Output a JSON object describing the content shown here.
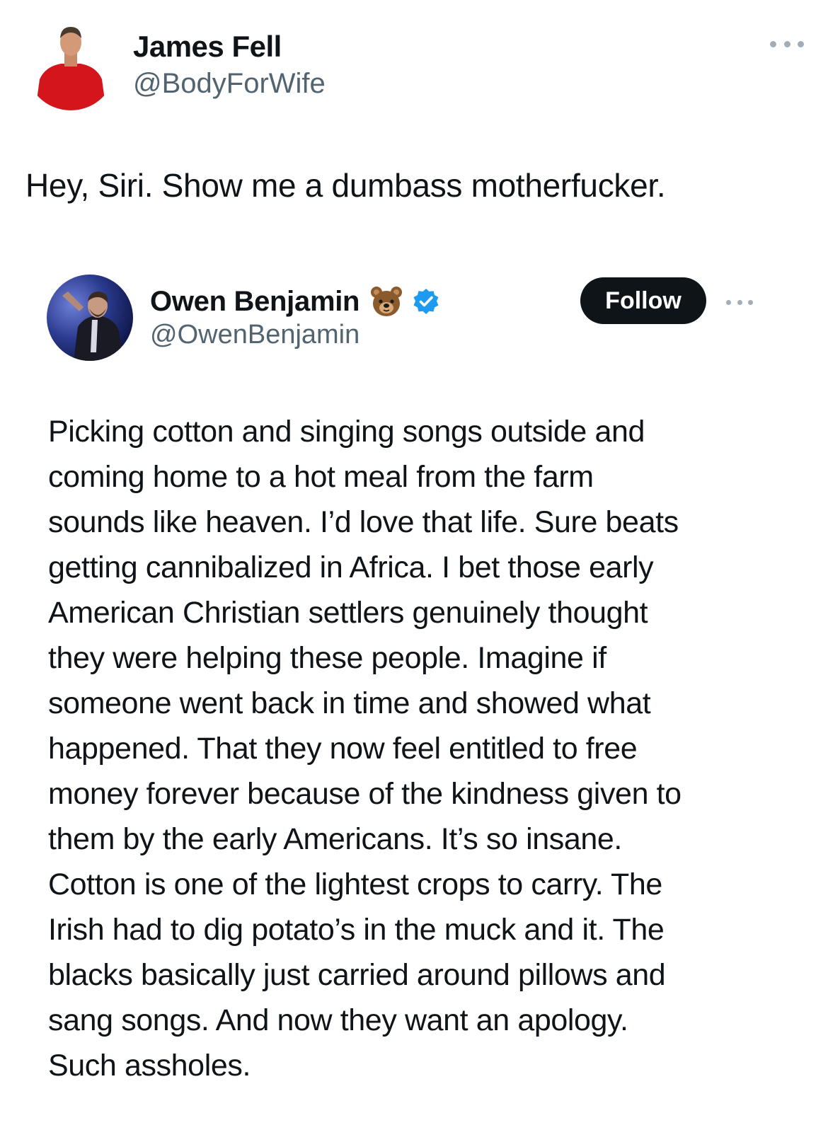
{
  "outer_tweet": {
    "author_name": "James Fell",
    "author_handle": "@BodyForWife",
    "more_icon": "more-dots-icon",
    "text": "Hey, Siri. Show me a dumbass motherfucker."
  },
  "quoted_tweet": {
    "author_name": "Owen Benjamin",
    "author_handle": "@OwenBenjamin",
    "name_emoji_icon": "bear-face-icon",
    "verified_icon": "verified-badge-icon",
    "follow_label": "Follow",
    "more_icon": "more-dots-icon",
    "text_lines": [
      "Picking cotton and singing songs outside and",
      "coming home to a hot meal from the farm",
      "sounds like heaven. I’d love that life. Sure beats",
      "getting cannibalized in Africa. I bet those early",
      "American Christian settlers genuinely thought",
      "they were helping these people. Imagine if",
      "someone went back in time and showed what",
      "happened. That they now feel entitled to free",
      "money forever because of the kindness given to",
      "them by the early Americans. It’s so insane.",
      "Cotton is one of the lightest crops to carry. The",
      "Irish had to dig potato’s in the muck and it. The",
      "blacks basically just carried around pillows and",
      "sang songs. And now they want an apology.",
      "Such assholes."
    ]
  },
  "colors": {
    "text_primary": "#0f1419",
    "text_secondary": "#536471",
    "verified_blue": "#1d9bf0",
    "follow_bg": "#0f1419",
    "avatar_shirt": "#d4161c"
  }
}
